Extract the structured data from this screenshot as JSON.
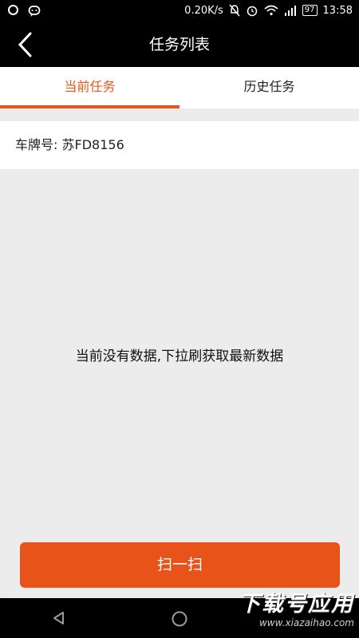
{
  "status_bar": {
    "network_speed": "0.20K/s",
    "battery": "97",
    "time": "13:58",
    "icons": [
      "circle-icon",
      "chat-icon",
      "mute-icon",
      "alarm-icon",
      "wifi-icon",
      "signal-icon",
      "battery-icon"
    ]
  },
  "header": {
    "title": "任务列表",
    "back_icon": "chevron-left-icon"
  },
  "tabs": [
    {
      "label": "当前任务",
      "active": true
    },
    {
      "label": "历史任务",
      "active": false
    }
  ],
  "plate": {
    "label": "车牌号:",
    "value": "苏FD8156"
  },
  "empty_message": "当前没有数据,下拉刷获取最新数据",
  "scan_button": {
    "label": "扫一扫"
  },
  "nav_bar": {
    "icons": [
      "back-triangle-icon",
      "home-circle-icon"
    ]
  },
  "watermark": {
    "text": "下载号应用",
    "url": "www.xiazaihao.com"
  },
  "colors": {
    "accent": "#e8571a",
    "button": "#e8531a",
    "background": "#ececec",
    "bar": "#000000"
  }
}
